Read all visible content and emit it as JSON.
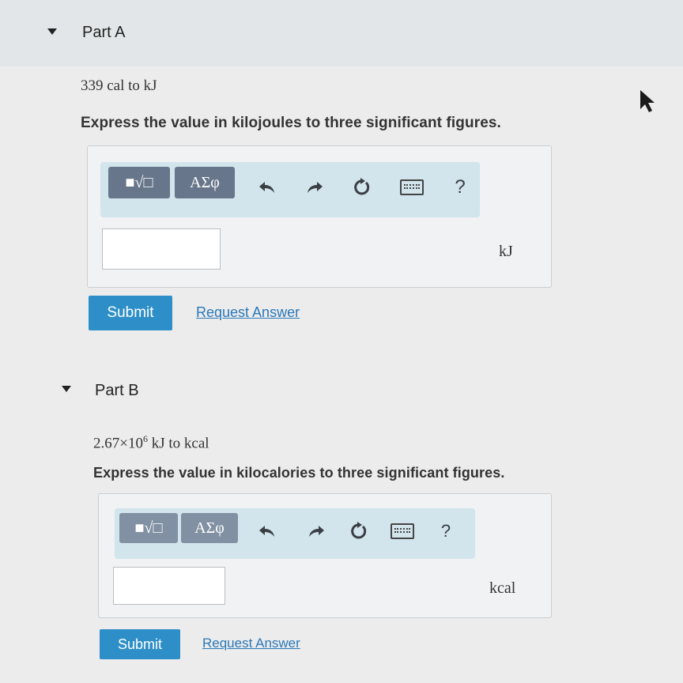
{
  "partA": {
    "title": "Part A",
    "problem": "339 cal to kJ",
    "instruction": "Express the value in kilojoules to three significant figures.",
    "toolbar": {
      "templates_label": "■√□",
      "symbols_label": "ΑΣφ",
      "help_label": "?"
    },
    "input_value": "",
    "unit": "kJ",
    "submit_label": "Submit",
    "request_answer_label": "Request Answer"
  },
  "partB": {
    "title": "Part B",
    "problem_mantissa": "2.67×10",
    "problem_exponent": "6",
    "problem_rest": " kJ to kcal",
    "instruction": "Express the value in kilocalories to three significant figures.",
    "toolbar": {
      "templates_label": "■√□",
      "symbols_label": "ΑΣφ",
      "help_label": "?"
    },
    "input_value": "",
    "unit": "kcal",
    "submit_label": "Submit",
    "request_answer_label": "Request Answer"
  },
  "icons": [
    "caret-down-icon",
    "undo-icon",
    "redo-icon",
    "reset-icon",
    "keyboard-icon",
    "help-icon",
    "mouse-cursor-icon"
  ],
  "colors": {
    "header_bg": "#e3e6e8",
    "toolbar_bg": "#d2e4ec",
    "toolbar_button": "#67768a",
    "submit": "#2e8fc8",
    "link": "#2a78b8"
  }
}
